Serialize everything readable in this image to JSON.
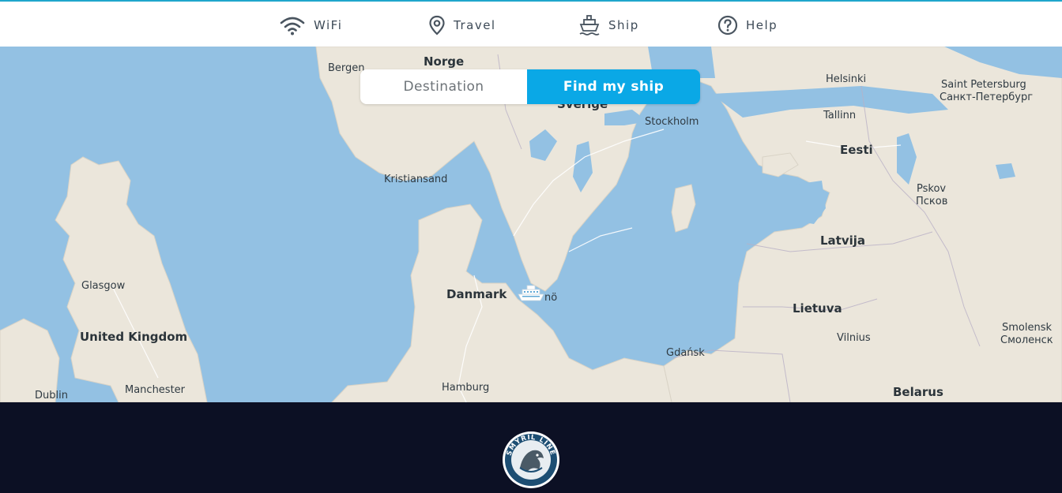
{
  "nav": {
    "items": [
      {
        "label": "WiFi",
        "icon": "wifi-icon"
      },
      {
        "label": "Travel",
        "icon": "location-pin-icon"
      },
      {
        "label": "Ship",
        "icon": "ship-icon"
      },
      {
        "label": "Help",
        "icon": "help-icon"
      }
    ]
  },
  "toggle": {
    "destination_label": "Destination",
    "find_ship_label": "Find my ship",
    "active": "Find my ship"
  },
  "map": {
    "places": {
      "norge": "Norge",
      "sverige": "Sverige",
      "bergen": "Bergen",
      "kristiansand": "Kristiansand",
      "stockholm": "Stockholm",
      "helsinki": "Helsinki",
      "saint_petersburg": "Saint Petersburg",
      "saint_petersburg_ru": "Санкт-Петербург",
      "tallinn": "Tallinn",
      "eesti": "Eesti",
      "pskov": "Pskov",
      "pskov_ru": "Псков",
      "latvija": "Latvija",
      "lietuva": "Lietuva",
      "vilnius": "Vilnius",
      "smolensk": "Smolensk",
      "smolensk_ru": "Смоленск",
      "belarus": "Belarus",
      "gdansk": "Gdańsk",
      "danmark": "Danmark",
      "malmo_partial": "nö",
      "hamburg": "Hamburg",
      "glasgow": "Glasgow",
      "united_kingdom": "United Kingdom",
      "manchester": "Manchester",
      "dublin": "Dublin"
    }
  },
  "footer": {
    "logo_text": "SMYRIL LINE"
  },
  "colors": {
    "accent": "#0aa8e6",
    "sea": "#93c1e3",
    "land": "#ebe6db",
    "footer": "#0c1024"
  }
}
